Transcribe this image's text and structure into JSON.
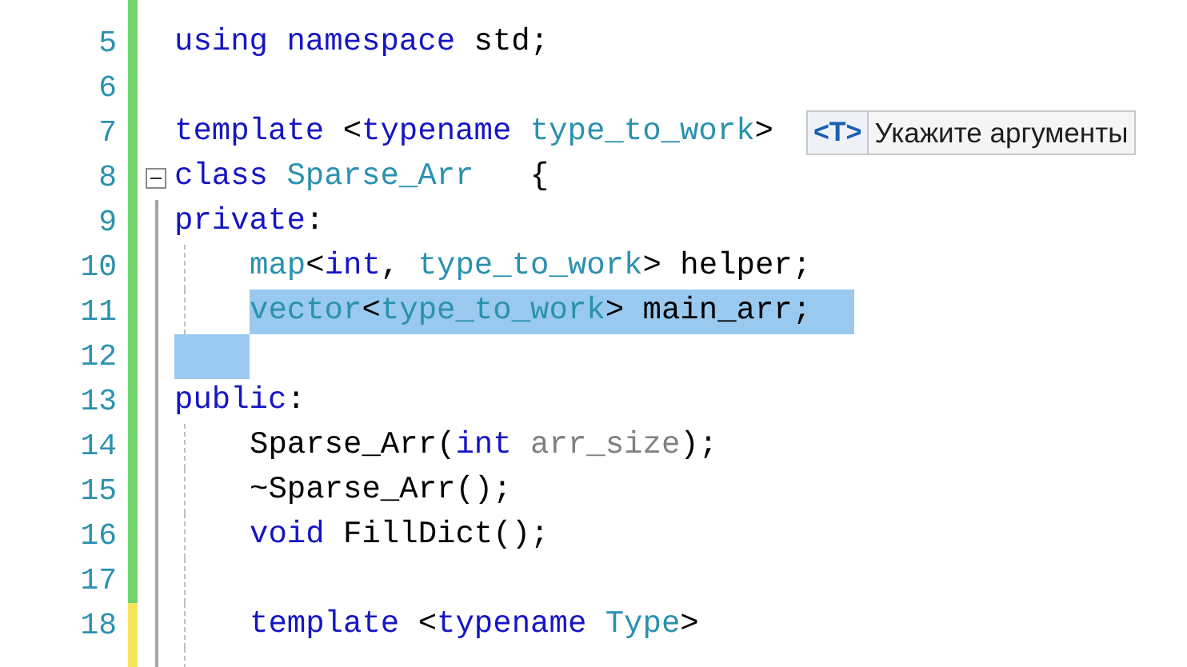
{
  "lines": [
    {
      "unsaved": false
    },
    {
      "number": "5",
      "unsaved": false,
      "tokens": [
        {
          "kind": "keyword",
          "text": "using"
        },
        {
          "kind": "keyword",
          "text": " namespace"
        },
        {
          "kind": "plain",
          "text": " std;"
        }
      ]
    },
    {
      "number": "6",
      "unsaved": false
    },
    {
      "number": "7",
      "unsaved": false,
      "tokens": [
        {
          "kind": "keyword",
          "text": "template"
        },
        {
          "kind": "plain",
          "text": " <"
        },
        {
          "kind": "keyword",
          "text": "typename"
        },
        {
          "kind": "type",
          "text": " type_to_work"
        },
        {
          "kind": "plain",
          "text": ">"
        }
      ],
      "hint": {
        "badge": "<T>",
        "text": "Укажите аргументы"
      }
    },
    {
      "number": "8",
      "unsaved": false,
      "fold": true,
      "tokens": [
        {
          "kind": "keyword",
          "text": "class"
        },
        {
          "kind": "type",
          "text": " Sparse_Arr"
        },
        {
          "kind": "plain",
          "text": "   {"
        }
      ]
    },
    {
      "number": "9",
      "unsaved": false,
      "in_block": true,
      "tokens": [
        {
          "kind": "keyword",
          "text": "private"
        },
        {
          "kind": "plain",
          "text": ":"
        }
      ]
    },
    {
      "number": "10",
      "unsaved": false,
      "in_block": true,
      "indented": true,
      "guide": true,
      "tokens": [
        {
          "kind": "type",
          "text": "map"
        },
        {
          "kind": "plain",
          "text": "<"
        },
        {
          "kind": "keyword",
          "text": "int"
        },
        {
          "kind": "plain",
          "text": ","
        },
        {
          "kind": "type",
          "text": " type_to_work"
        },
        {
          "kind": "plain",
          "text": "> helper;"
        }
      ]
    },
    {
      "number": "11",
      "unsaved": false,
      "in_block": true,
      "indented": true,
      "guide": true,
      "selected": true,
      "tokens": [
        {
          "kind": "type",
          "text": "vector"
        },
        {
          "kind": "plain",
          "text": "<"
        },
        {
          "kind": "type",
          "text": "type_to_work"
        },
        {
          "kind": "plain",
          "text": "> main_arr;"
        }
      ]
    },
    {
      "number": "12",
      "unsaved": false,
      "in_block": true,
      "guide": true,
      "selected": true
    },
    {
      "number": "13",
      "unsaved": false,
      "in_block": true,
      "tokens": [
        {
          "kind": "keyword",
          "text": "public"
        },
        {
          "kind": "plain",
          "text": ":"
        }
      ]
    },
    {
      "number": "14",
      "unsaved": false,
      "in_block": true,
      "indented": true,
      "guide": true,
      "tokens": [
        {
          "kind": "plain",
          "text": "Sparse_Arr("
        },
        {
          "kind": "keyword",
          "text": "int"
        },
        {
          "kind": "param",
          "text": " arr_size"
        },
        {
          "kind": "plain",
          "text": ");"
        }
      ]
    },
    {
      "number": "15",
      "unsaved": false,
      "in_block": true,
      "indented": true,
      "guide": true,
      "tokens": [
        {
          "kind": "plain",
          "text": "~Sparse_Arr();"
        }
      ]
    },
    {
      "number": "16",
      "unsaved": false,
      "in_block": true,
      "indented": true,
      "guide": true,
      "tokens": [
        {
          "kind": "keyword",
          "text": "void"
        },
        {
          "kind": "plain",
          "text": " FillDict();"
        }
      ]
    },
    {
      "number": "17",
      "unsaved": false,
      "in_block": true,
      "guide": true
    },
    {
      "number": "18",
      "unsaved": true,
      "in_block": true,
      "indented": true,
      "guide": true,
      "tokens": [
        {
          "kind": "keyword",
          "text": "template"
        },
        {
          "kind": "plain",
          "text": " <"
        },
        {
          "kind": "keyword",
          "text": "typename"
        },
        {
          "kind": "type",
          "text": " Type"
        },
        {
          "kind": "plain",
          "text": ">"
        }
      ]
    },
    {
      "unsaved": true,
      "in_block": true,
      "guide": true
    }
  ]
}
